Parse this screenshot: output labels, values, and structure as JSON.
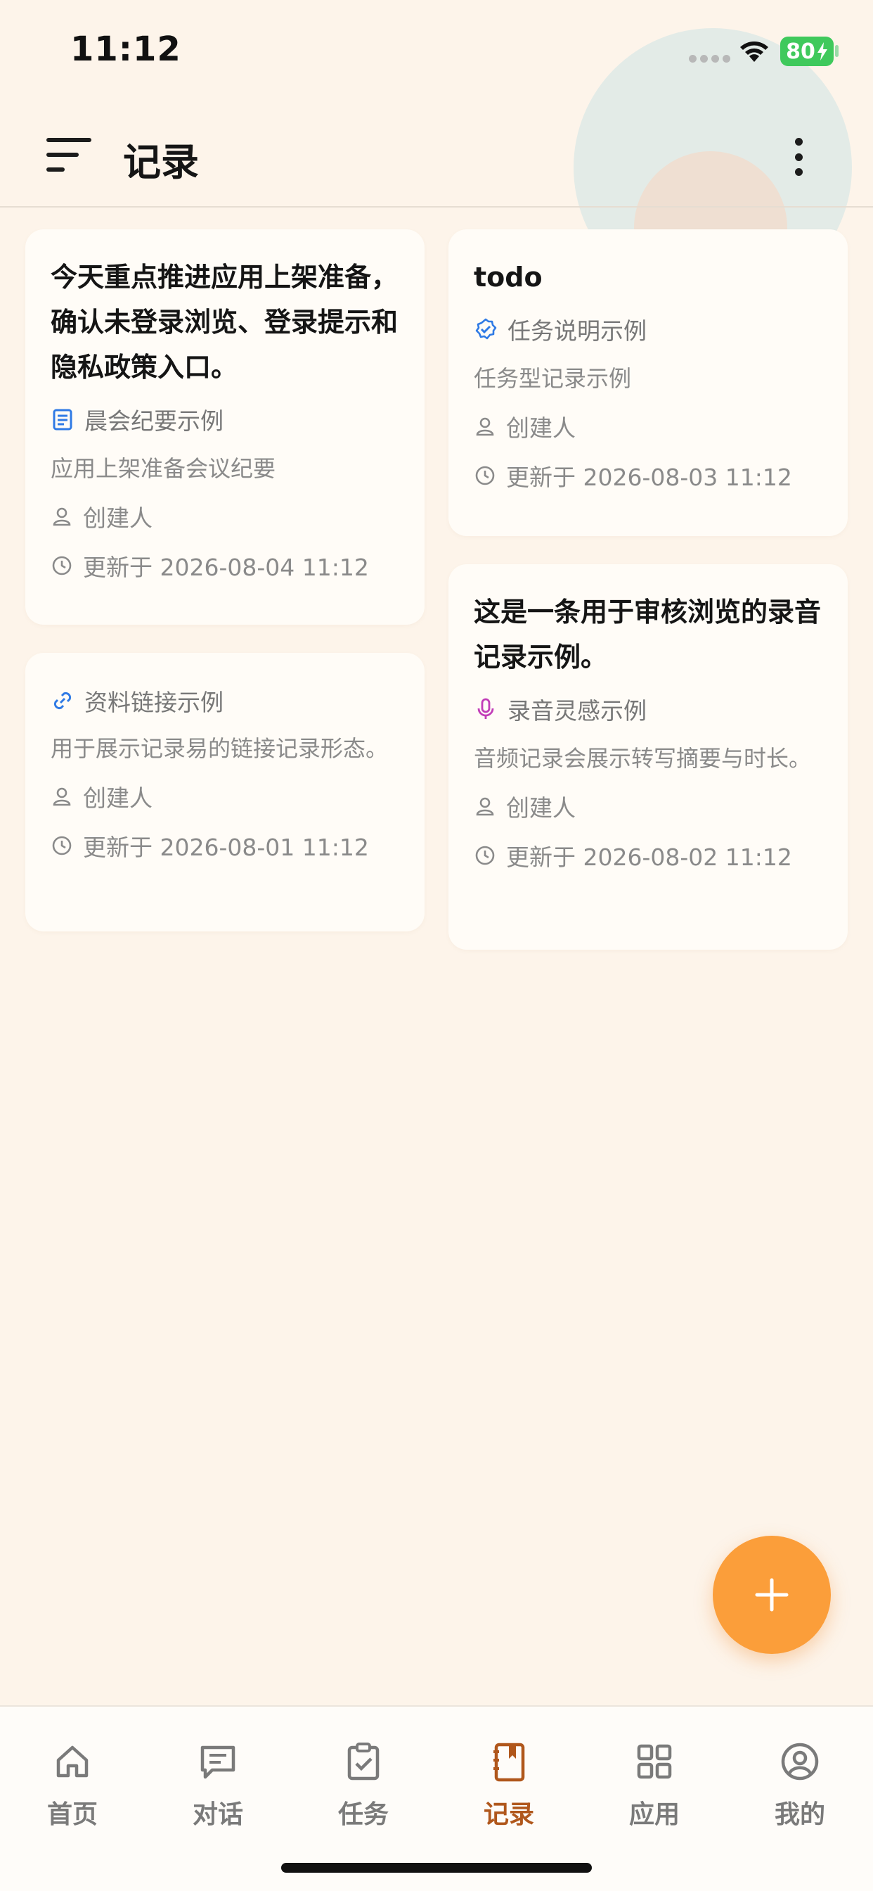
{
  "status_bar": {
    "time": "11:12",
    "battery": "80"
  },
  "header": {
    "title": "记录"
  },
  "colors": {
    "accent": "#b0571c",
    "fab": "#fb9e3a",
    "background": "#fdf4ea",
    "blue_icon": "#2f7ae5",
    "pink_icon": "#c23db8"
  },
  "cards": [
    {
      "title": "今天重点推进应用上架准备，确认未登录浏览、登录提示和隐私政策入口。",
      "tag_icon": "document-icon",
      "tag": "晨会纪要示例",
      "desc": "应用上架准备会议纪要",
      "creator": "创建人",
      "updated": "更新于 2026-08-04 11:12"
    },
    {
      "title": "todo",
      "tag_icon": "verified-badge-icon",
      "tag": "任务说明示例",
      "desc": "任务型记录示例",
      "creator": "创建人",
      "updated": "更新于 2026-08-03 11:12"
    },
    {
      "title": "",
      "tag_icon": "link-icon",
      "tag": "资料链接示例",
      "desc": "用于展示记录易的链接记录形态。",
      "creator": "创建人",
      "updated": "更新于 2026-08-01 11:12"
    },
    {
      "title": "这是一条用于审核浏览的录音记录示例。",
      "tag_icon": "microphone-icon",
      "tag": "录音灵感示例",
      "desc": "音频记录会展示转写摘要与时长。",
      "creator": "创建人",
      "updated": "更新于 2026-08-02 11:12"
    }
  ],
  "tabs": [
    {
      "label": "首页",
      "icon": "home-icon",
      "active": false
    },
    {
      "label": "对话",
      "icon": "chat-icon",
      "active": false
    },
    {
      "label": "任务",
      "icon": "clipboard-check-icon",
      "active": false
    },
    {
      "label": "记录",
      "icon": "notebook-icon",
      "active": true
    },
    {
      "label": "应用",
      "icon": "grid-icon",
      "active": false
    },
    {
      "label": "我的",
      "icon": "user-circle-icon",
      "active": false
    }
  ]
}
